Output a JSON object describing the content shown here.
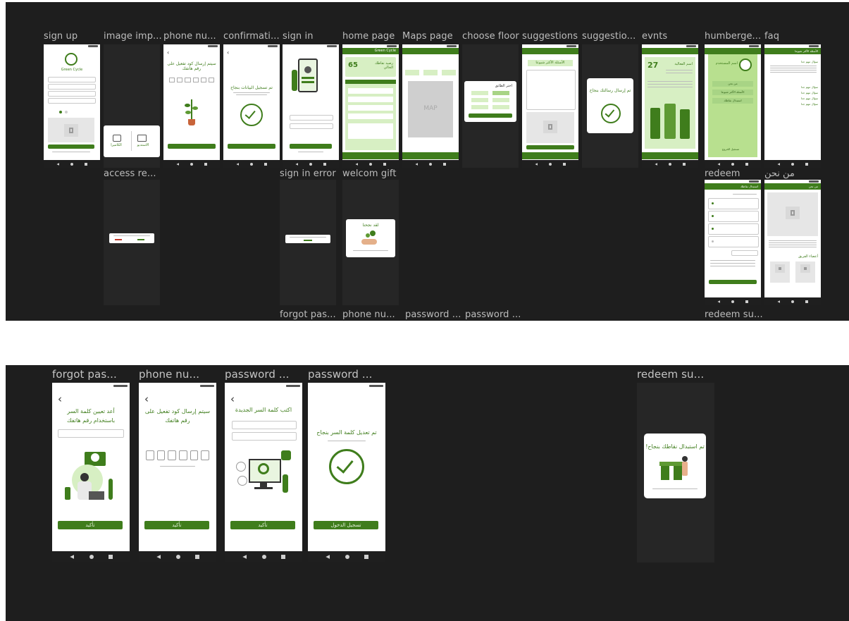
{
  "top_labels": [
    "sign up",
    "image imp...",
    "phone nu...",
    "confirmati...",
    "sign in",
    "home page",
    "Maps page",
    "choose floor",
    "suggestions",
    "suggestio...",
    "evnts",
    "humberge...",
    "faq"
  ],
  "top_row2_labels": {
    "access": "access re...",
    "signin_error": "sign in error",
    "welcome_gift": "welcom gift",
    "redeem": "redeem",
    "about": "من نحن"
  },
  "top_bottom_labels": [
    "forgot pas...",
    "phone nu...",
    "password ...",
    "password ...",
    "redeem su..."
  ],
  "bottom_labels": [
    "forgot pas...",
    "phone nu...",
    "password ...",
    "password ...",
    "redeem su..."
  ],
  "screens": {
    "signup": {
      "logo_text": "Green Cycle"
    },
    "image_import": {
      "camera": "الكاميرا",
      "gallery": "الاستديو"
    },
    "phone_small": {
      "title": "سيتم إرسال كود تفعيل على رقم هاتفك"
    },
    "confirm_small": {
      "title": "تم تسجيل البيانات بنجاح"
    },
    "home": {
      "header": "Green Cycle",
      "points": "65",
      "points_caption": "رصيد نقاطك الحالي"
    },
    "maps": {
      "map": "MAP"
    },
    "choose_floor": {
      "title": "اختر الطابق"
    },
    "suggestions": {
      "title": "الأسئلة الأكثر شيوعا"
    },
    "suggestion_sent": {
      "title": "تم إرسال رسالتك بنجاح"
    },
    "events": {
      "day": "27",
      "title": "اسم الفعالية"
    },
    "hamburger": {
      "user": "اسم المستخدم",
      "items": [
        "من نحن",
        "الأسئلة الأكثر شيوعا",
        "استبدال نقاطك"
      ],
      "logout": "تسجيل الخروج"
    },
    "faq": {
      "title": "الأسئلة الأكثر شيوعا",
      "q1": "سؤال مهم جدا",
      "questions": [
        "سؤال مهم جدا",
        "سؤال مهم جدا",
        "سؤال مهم جدا",
        "سؤال مهم جدا"
      ]
    },
    "redeem": {
      "header": "استبدال نقاطك"
    },
    "about": {
      "header": "من نحن",
      "section": "أعضاء الفريق"
    },
    "welcome_gift": {
      "title": "لقد نجحنا"
    }
  },
  "bottom_screens": {
    "forgot": {
      "title": "أعد تعيين كلمة السر باستخدام رقم هاتفك",
      "button": "تأكيد"
    },
    "phone": {
      "title": "سيتم إرسال كود تفعيل على رقم هاتفك",
      "button": "تأكيد"
    },
    "new_password": {
      "title": "اكتب كلمة السر الجديدة",
      "button": "تأكيد"
    },
    "password_success": {
      "title": "تم تعديل كلمة السر بنجاح",
      "button": "تسجيل الدخول"
    },
    "redeem_success": {
      "title": "تم استبدال نقاطك بنجاح!"
    }
  }
}
